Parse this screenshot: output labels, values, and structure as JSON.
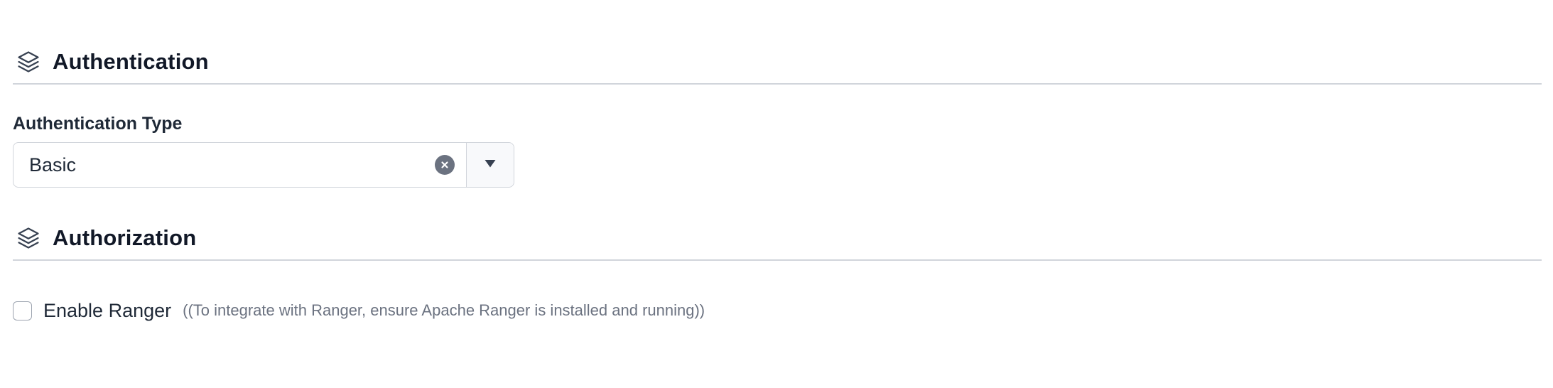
{
  "sections": {
    "authentication": {
      "title": "Authentication",
      "icon": "layers-icon"
    },
    "authorization": {
      "title": "Authorization",
      "icon": "layers-icon"
    }
  },
  "authentication_type": {
    "label": "Authentication Type",
    "selected_value": "Basic",
    "clear_icon": "clear-icon",
    "dropdown_icon": "caret-down-icon"
  },
  "ranger": {
    "label": "Enable Ranger",
    "hint": "((To integrate with Ranger, ensure Apache Ranger is installed and running))",
    "checked": false
  },
  "colors": {
    "text_primary": "#111827",
    "text_muted": "#6b7280",
    "border": "#d1d5db",
    "clear_button": "#6b7280"
  }
}
